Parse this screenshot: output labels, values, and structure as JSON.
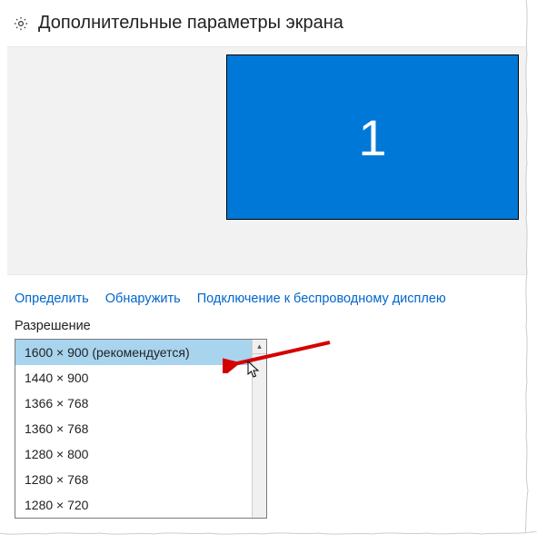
{
  "header": {
    "title": "Дополнительные параметры экрана"
  },
  "display": {
    "monitor_number": "1"
  },
  "links": {
    "identify": "Определить",
    "detect": "Обнаружить",
    "wireless": "Подключение к беспроводному дисплею"
  },
  "resolution": {
    "label": "Разрешение",
    "selected_index": 0,
    "options": [
      "1600 × 900 (рекомендуется)",
      "1440 × 900",
      "1366 × 768",
      "1360 × 768",
      "1280 × 800",
      "1280 × 768",
      "1280 × 720"
    ]
  },
  "colors": {
    "accent": "#0078d7",
    "link": "#0066cc",
    "selected_bg": "#a8d4ee"
  }
}
